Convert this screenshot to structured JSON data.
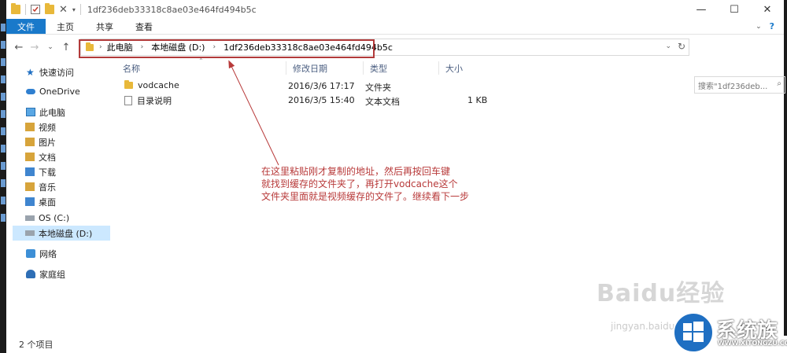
{
  "window": {
    "title": "1df236deb33318c8ae03e464fd494b5c",
    "minimize": "—",
    "maximize": "☐",
    "close": "✕"
  },
  "ribbon": {
    "tabs": [
      "文件",
      "主页",
      "共享",
      "查看"
    ],
    "active_tab": "文件"
  },
  "nav": {
    "back": "←",
    "forward": "→",
    "recent": "⌄",
    "up": "↑"
  },
  "address": {
    "crumbs": [
      "此电脑",
      "本地磁盘 (D:)",
      "1df236deb33318c8ae03e464fd494b5c"
    ]
  },
  "search": {
    "placeholder": "搜索\"1df236deb...",
    "icon": "search-icon"
  },
  "sidebar": {
    "items": [
      {
        "label": "快速访问",
        "icon": "star-icon"
      },
      {
        "label": "OneDrive",
        "icon": "cloud-icon"
      },
      {
        "label": "此电脑",
        "icon": "computer-icon"
      },
      {
        "label": "视频",
        "icon": "video-folder-icon"
      },
      {
        "label": "图片",
        "icon": "pictures-folder-icon"
      },
      {
        "label": "文档",
        "icon": "documents-folder-icon"
      },
      {
        "label": "下载",
        "icon": "downloads-folder-icon"
      },
      {
        "label": "音乐",
        "icon": "music-folder-icon"
      },
      {
        "label": "桌面",
        "icon": "desktop-folder-icon"
      },
      {
        "label": "OS (C:)",
        "icon": "drive-icon"
      },
      {
        "label": "本地磁盘 (D:)",
        "icon": "drive-icon",
        "selected": true
      },
      {
        "label": "网络",
        "icon": "network-icon"
      },
      {
        "label": "家庭组",
        "icon": "homegroup-icon"
      }
    ]
  },
  "columns": {
    "name": "名称",
    "modified": "修改日期",
    "type": "类型",
    "size": "大小"
  },
  "files": [
    {
      "name": "vodcache",
      "modified": "2016/3/6 17:17",
      "type": "文件夹",
      "size": "",
      "icon": "folder-icon"
    },
    {
      "name": "目录说明",
      "modified": "2016/3/5 15:40",
      "type": "文本文档",
      "size": "1 KB",
      "icon": "text-file-icon"
    }
  ],
  "annotation": {
    "lines": [
      "在这里粘贴刚才复制的地址，然后再按回车键",
      "就找到缓存的文件夹了，再打开vodcache这个",
      "文件夹里面就是视频缓存的文件了。继续看下一步"
    ],
    "color": "#b83a3a"
  },
  "status": {
    "count": "2 个项目"
  },
  "watermark": {
    "baidu": "Baidu经验",
    "jingyan": "jingyan.baidu.com",
    "logo_text": "系统族",
    "logo_url": "WWW.XITONGZU.COM"
  },
  "colors": {
    "accent": "#1979ca",
    "selection": "#cce8ff",
    "highlight_box": "#b23a3a"
  }
}
